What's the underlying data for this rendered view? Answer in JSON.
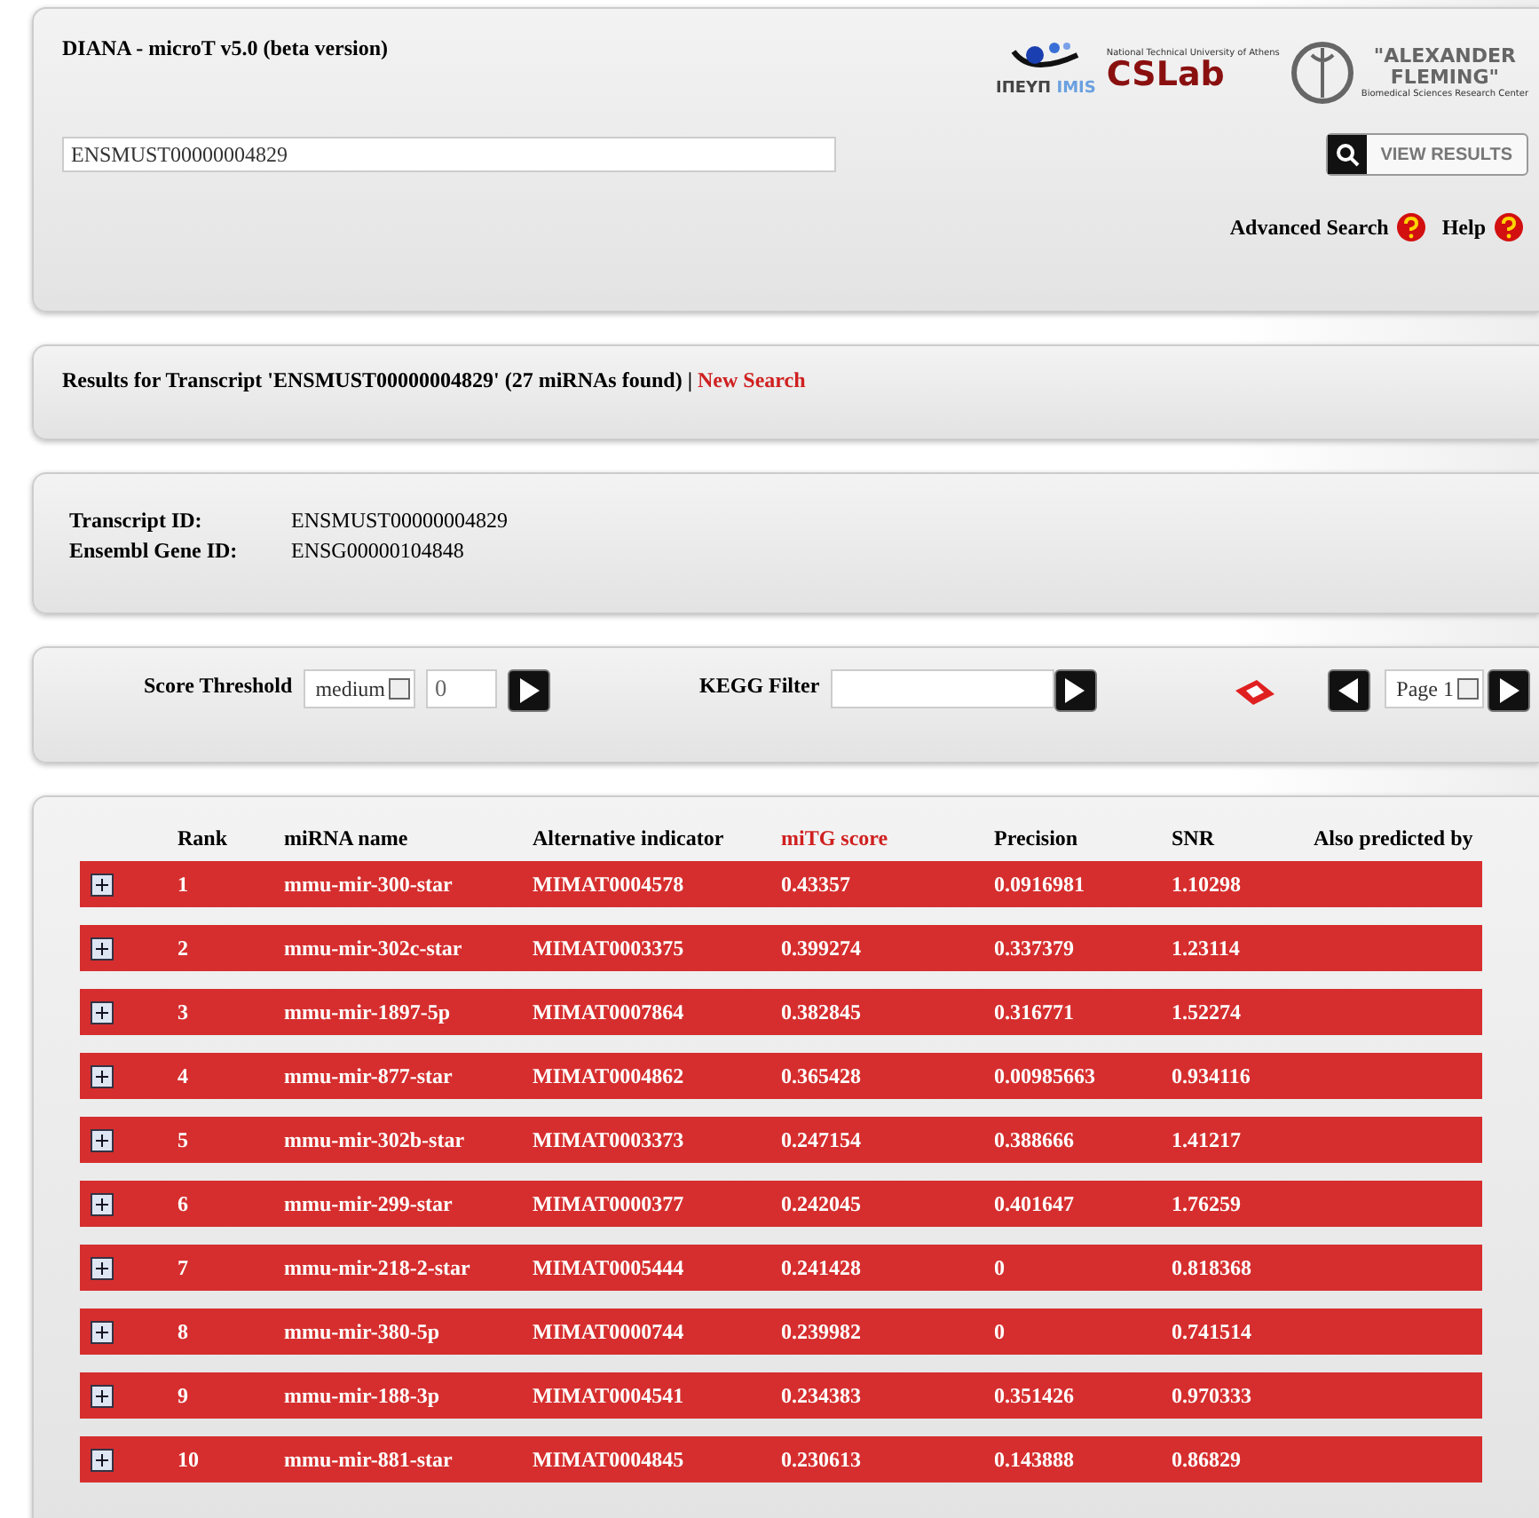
{
  "header": {
    "title": "DIANA - microT v5.0 (beta version)",
    "logos": [
      {
        "kind": "imis",
        "texts": [
          "ΙΠΕΥΠ",
          "IMIS"
        ]
      },
      {
        "kind": "cslab",
        "texts": [
          "National Technical University of Athens",
          "CSLab"
        ]
      },
      {
        "kind": "fleming",
        "texts": [
          "\"ALEXANDER",
          "FLEMING\"",
          "Biomedical Sciences Research Center"
        ]
      }
    ],
    "search": {
      "value": "ENSMUST00000004829"
    },
    "view_button": "VIEW RESULTS",
    "links": [
      "Advanced Search",
      "Help"
    ]
  },
  "results_bar": {
    "text": "Results for Transcript 'ENSMUST00000004829' (27 miRNAs found) |",
    "link": "New Search"
  },
  "info": [
    {
      "label": "Transcript ID:",
      "value": "ENSMUST00000004829"
    },
    {
      "label": "Ensembl Gene ID:",
      "value": "ENSG00000104848"
    }
  ],
  "filters": {
    "score_label": "Score Threshold",
    "score_select": "medium",
    "score_value": "0",
    "kegg_label": "KEGG Filter",
    "page_select": "Page 1"
  },
  "table": {
    "columns": [
      {
        "label": "Rank",
        "sorted": false
      },
      {
        "label": "miRNA name",
        "sorted": false
      },
      {
        "label": "Alternative indicator",
        "sorted": false
      },
      {
        "label": "miTG score",
        "sorted": true
      },
      {
        "label": "Precision",
        "sorted": false
      },
      {
        "label": "SNR",
        "sorted": false
      },
      {
        "label": "Also predicted by",
        "sorted": false
      }
    ],
    "rows": [
      [
        "1",
        "mmu-mir-300-star",
        "MIMAT0004578",
        "0.43357",
        "0.0916981",
        "1.10298"
      ],
      [
        "2",
        "mmu-mir-302c-star",
        "MIMAT0003375",
        "0.399274",
        "0.337379",
        "1.23114"
      ],
      [
        "3",
        "mmu-mir-1897-5p",
        "MIMAT0007864",
        "0.382845",
        "0.316771",
        "1.52274"
      ],
      [
        "4",
        "mmu-mir-877-star",
        "MIMAT0004862",
        "0.365428",
        "0.00985663",
        "0.934116"
      ],
      [
        "5",
        "mmu-mir-302b-star",
        "MIMAT0003373",
        "0.247154",
        "0.388666",
        "1.41217"
      ],
      [
        "6",
        "mmu-mir-299-star",
        "MIMAT0000377",
        "0.242045",
        "0.401647",
        "1.76259"
      ],
      [
        "7",
        "mmu-mir-218-2-star",
        "MIMAT0005444",
        "0.241428",
        "0",
        "0.818368"
      ],
      [
        "8",
        "mmu-mir-380-5p",
        "MIMAT0000744",
        "0.239982",
        "0",
        "0.741514"
      ],
      [
        "9",
        "mmu-mir-188-3p",
        "MIMAT0004541",
        "0.234383",
        "0.351426",
        "0.970333"
      ],
      [
        "10",
        "mmu-mir-881-star",
        "MIMAT0004845",
        "0.230613",
        "0.143888",
        "0.86829"
      ]
    ]
  }
}
